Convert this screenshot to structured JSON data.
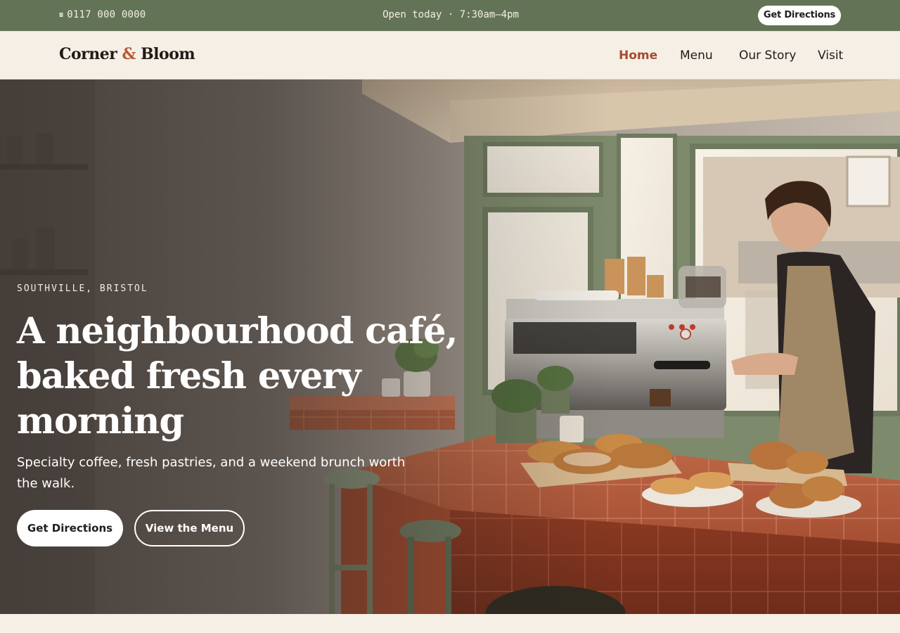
{
  "topbar": {
    "phone_icon": "☎",
    "phone": "0117 000 0000",
    "hours": "Open today · 7:30am–4pm",
    "directions_label": "Get Directions"
  },
  "header": {
    "logo_part1": "Corner ",
    "logo_amp": "&",
    "logo_part2": " Bloom",
    "nav": [
      "Home",
      "Menu",
      "Our Story",
      "Visit"
    ],
    "active_nav": "Home"
  },
  "hero": {
    "eyebrow": "SOUTHVILLE, BRISTOL",
    "headline": "A neighbourhood café, baked fresh every morning",
    "subtitle": "Specialty coffee, fresh pastries, and a weekend brunch worth the walk.",
    "primary_cta": "Get Directions",
    "secondary_cta": "View the Menu"
  },
  "colors": {
    "topbar_bg": "#637456",
    "page_bg": "#f6efe6",
    "accent": "#a44d2e",
    "tile_counter": "#b5583a"
  }
}
